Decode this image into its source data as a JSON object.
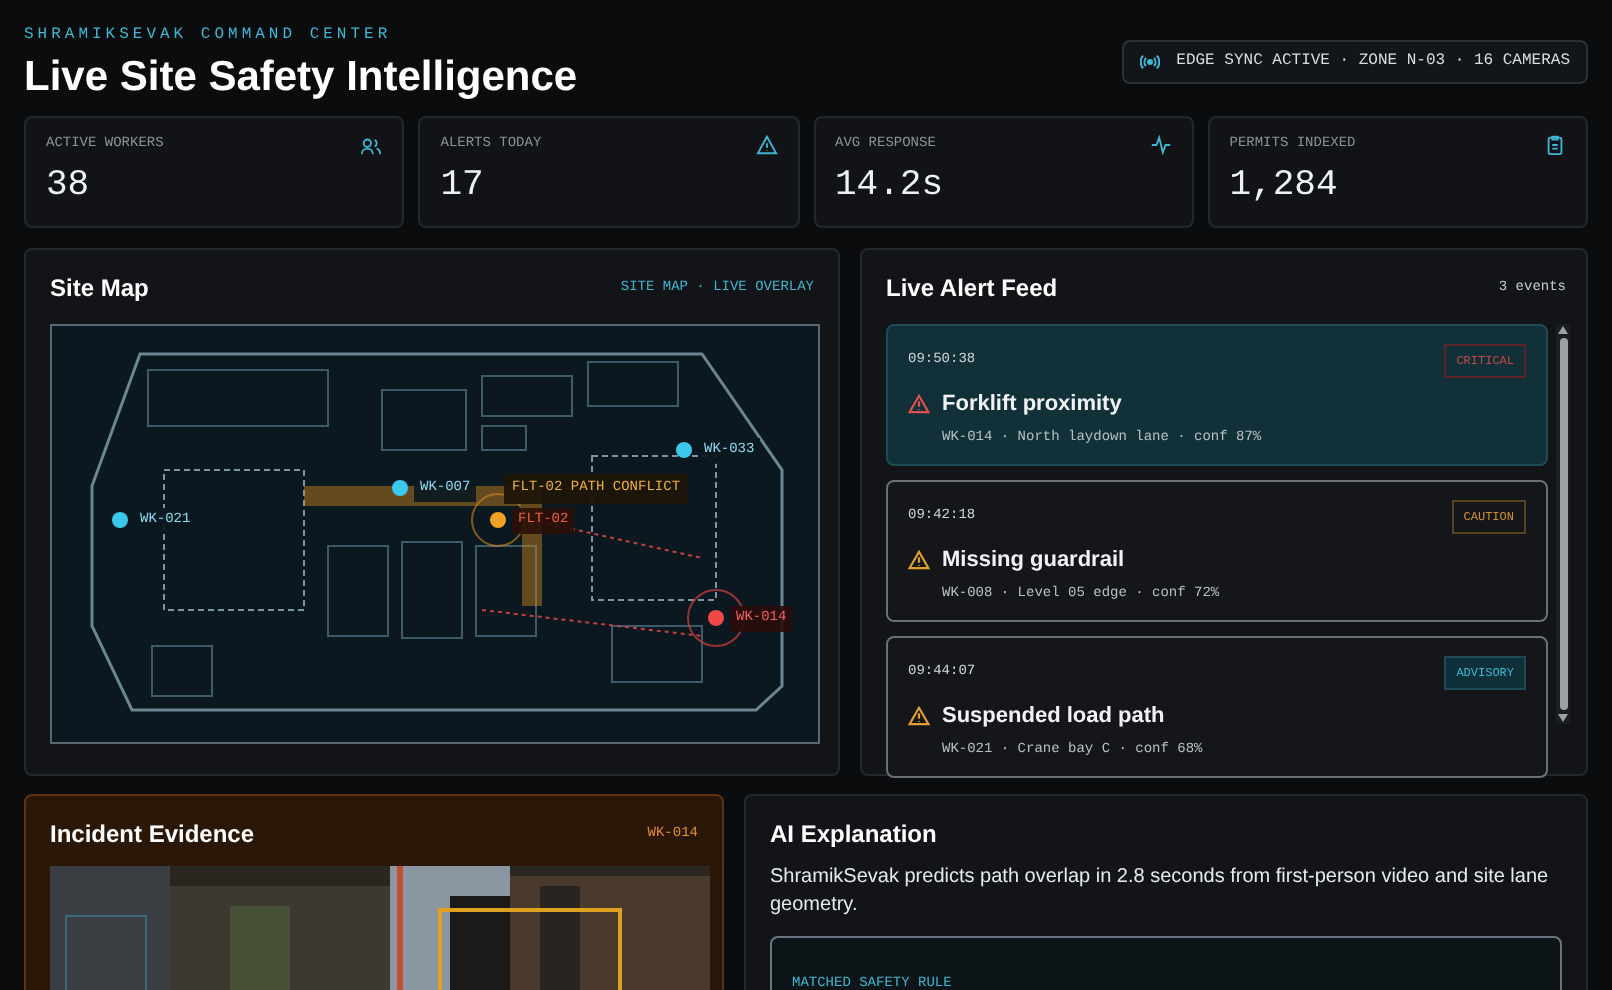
{
  "header": {
    "eyebrow": "SHRAMIKSEVAK COMMAND CENTER",
    "title": "Live Site Safety Intelligence",
    "sync_badge": "EDGE SYNC ACTIVE · ZONE N-03 · 16 CAMERAS"
  },
  "stats": [
    {
      "label": "ACTIVE WORKERS",
      "value": "38",
      "kind": "workers"
    },
    {
      "label": "ALERTS TODAY",
      "value": "17",
      "kind": "alerts"
    },
    {
      "label": "AVG RESPONSE",
      "value": "14.2s",
      "kind": "response"
    },
    {
      "label": "PERMITS INDEXED",
      "value": "1,284",
      "kind": "permits"
    }
  ],
  "site_map": {
    "title": "Site Map",
    "caption": "SITE MAP · LIVE OVERLAY",
    "conflict_label": "FLT-02 PATH CONFLICT",
    "markers": [
      {
        "label": "WK-021",
        "kind": "worker"
      },
      {
        "label": "WK-007",
        "kind": "worker"
      },
      {
        "label": "WK-033",
        "kind": "worker"
      },
      {
        "label": "FLT-02",
        "kind": "vehicle"
      },
      {
        "label": "WK-014",
        "kind": "alert"
      }
    ]
  },
  "alert_feed": {
    "title": "Live Alert Feed",
    "count": "3 events",
    "alerts": [
      {
        "time": "09:50:38",
        "title": "Forklift proximity",
        "meta": "WK-014 · North laydown lane · conf 87%",
        "badge": "CRITICAL",
        "kind": "critical",
        "selected": true
      },
      {
        "time": "09:42:18",
        "title": "Missing guardrail",
        "meta": "WK-008 · Level 05 edge · conf 72%",
        "badge": "CAUTION",
        "kind": "caution",
        "selected": false
      },
      {
        "time": "09:44:07",
        "title": "Suspended load path",
        "meta": "WK-021 · Crane bay C · conf 68%",
        "badge": "ADVISORY",
        "kind": "advisory",
        "selected": false
      }
    ]
  },
  "incident_evidence": {
    "title": "Incident Evidence",
    "worker_id": "WK-014"
  },
  "ai_explanation": {
    "title": "AI Explanation",
    "text": "ShramikSevak predicts path overlap in 2.8 seconds from first-person video and site lane geometry.",
    "rule_label": "MATCHED SAFETY RULE"
  }
}
